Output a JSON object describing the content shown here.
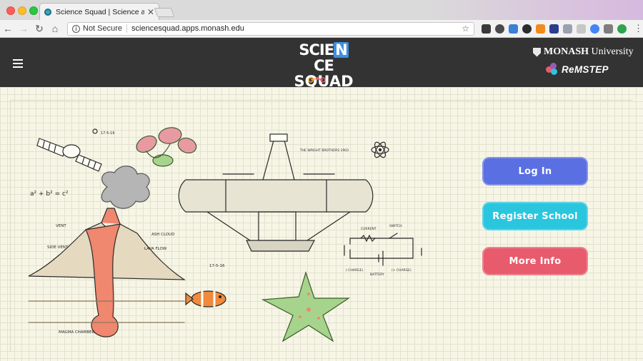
{
  "browser": {
    "tab_title": "Science Squad | Science activ",
    "tab_close": "✕",
    "security_label": "Not Secure",
    "url": "sciencesquad.apps.monash.edu",
    "extension_colors": [
      "#3a3a3a",
      "#4a4a4a",
      "#3b7fd6",
      "#2d2d2d",
      "#f28b1e",
      "#2b3d8f",
      "#9aa1b0",
      "#c7c7c7",
      "#4285f4",
      "#7e7e7e",
      "#2ea44f"
    ]
  },
  "site": {
    "logo_line1_a": "SCIE",
    "logo_line1_n": "N",
    "logo_line1_b": "CE",
    "logo_line2": "SQUAD",
    "university_a": "MONASH",
    "university_b": " University",
    "partner": "ReMSTEP"
  },
  "art": {
    "wright_note": "THE WRIGHT BROTHERS 1903",
    "formula": "a² + b² = c²",
    "date_1": "17-5-16",
    "date_2": "17-5-16",
    "label_vent": "VENT",
    "label_side_vent": "SIDE VENT",
    "label_ash_cloud": "ASH CLOUD",
    "label_lava_flow": "LAVA FLOW",
    "label_magma": "MAGMA CHAMBER",
    "label_current": "CURRENT",
    "label_switch": "SWITCH",
    "label_battery": "BATTERY",
    "label_neg": "(-CHARGE)",
    "label_pos": "(+ CHARGE)"
  },
  "actions": {
    "login": "Log In",
    "register": "Register School",
    "more_info": "More Info"
  },
  "colors": {
    "header_bg": "#333333",
    "login": "#5a6fe2",
    "register": "#2ac6de",
    "more_info": "#e85b6c",
    "paper": "#f7f6e6"
  }
}
